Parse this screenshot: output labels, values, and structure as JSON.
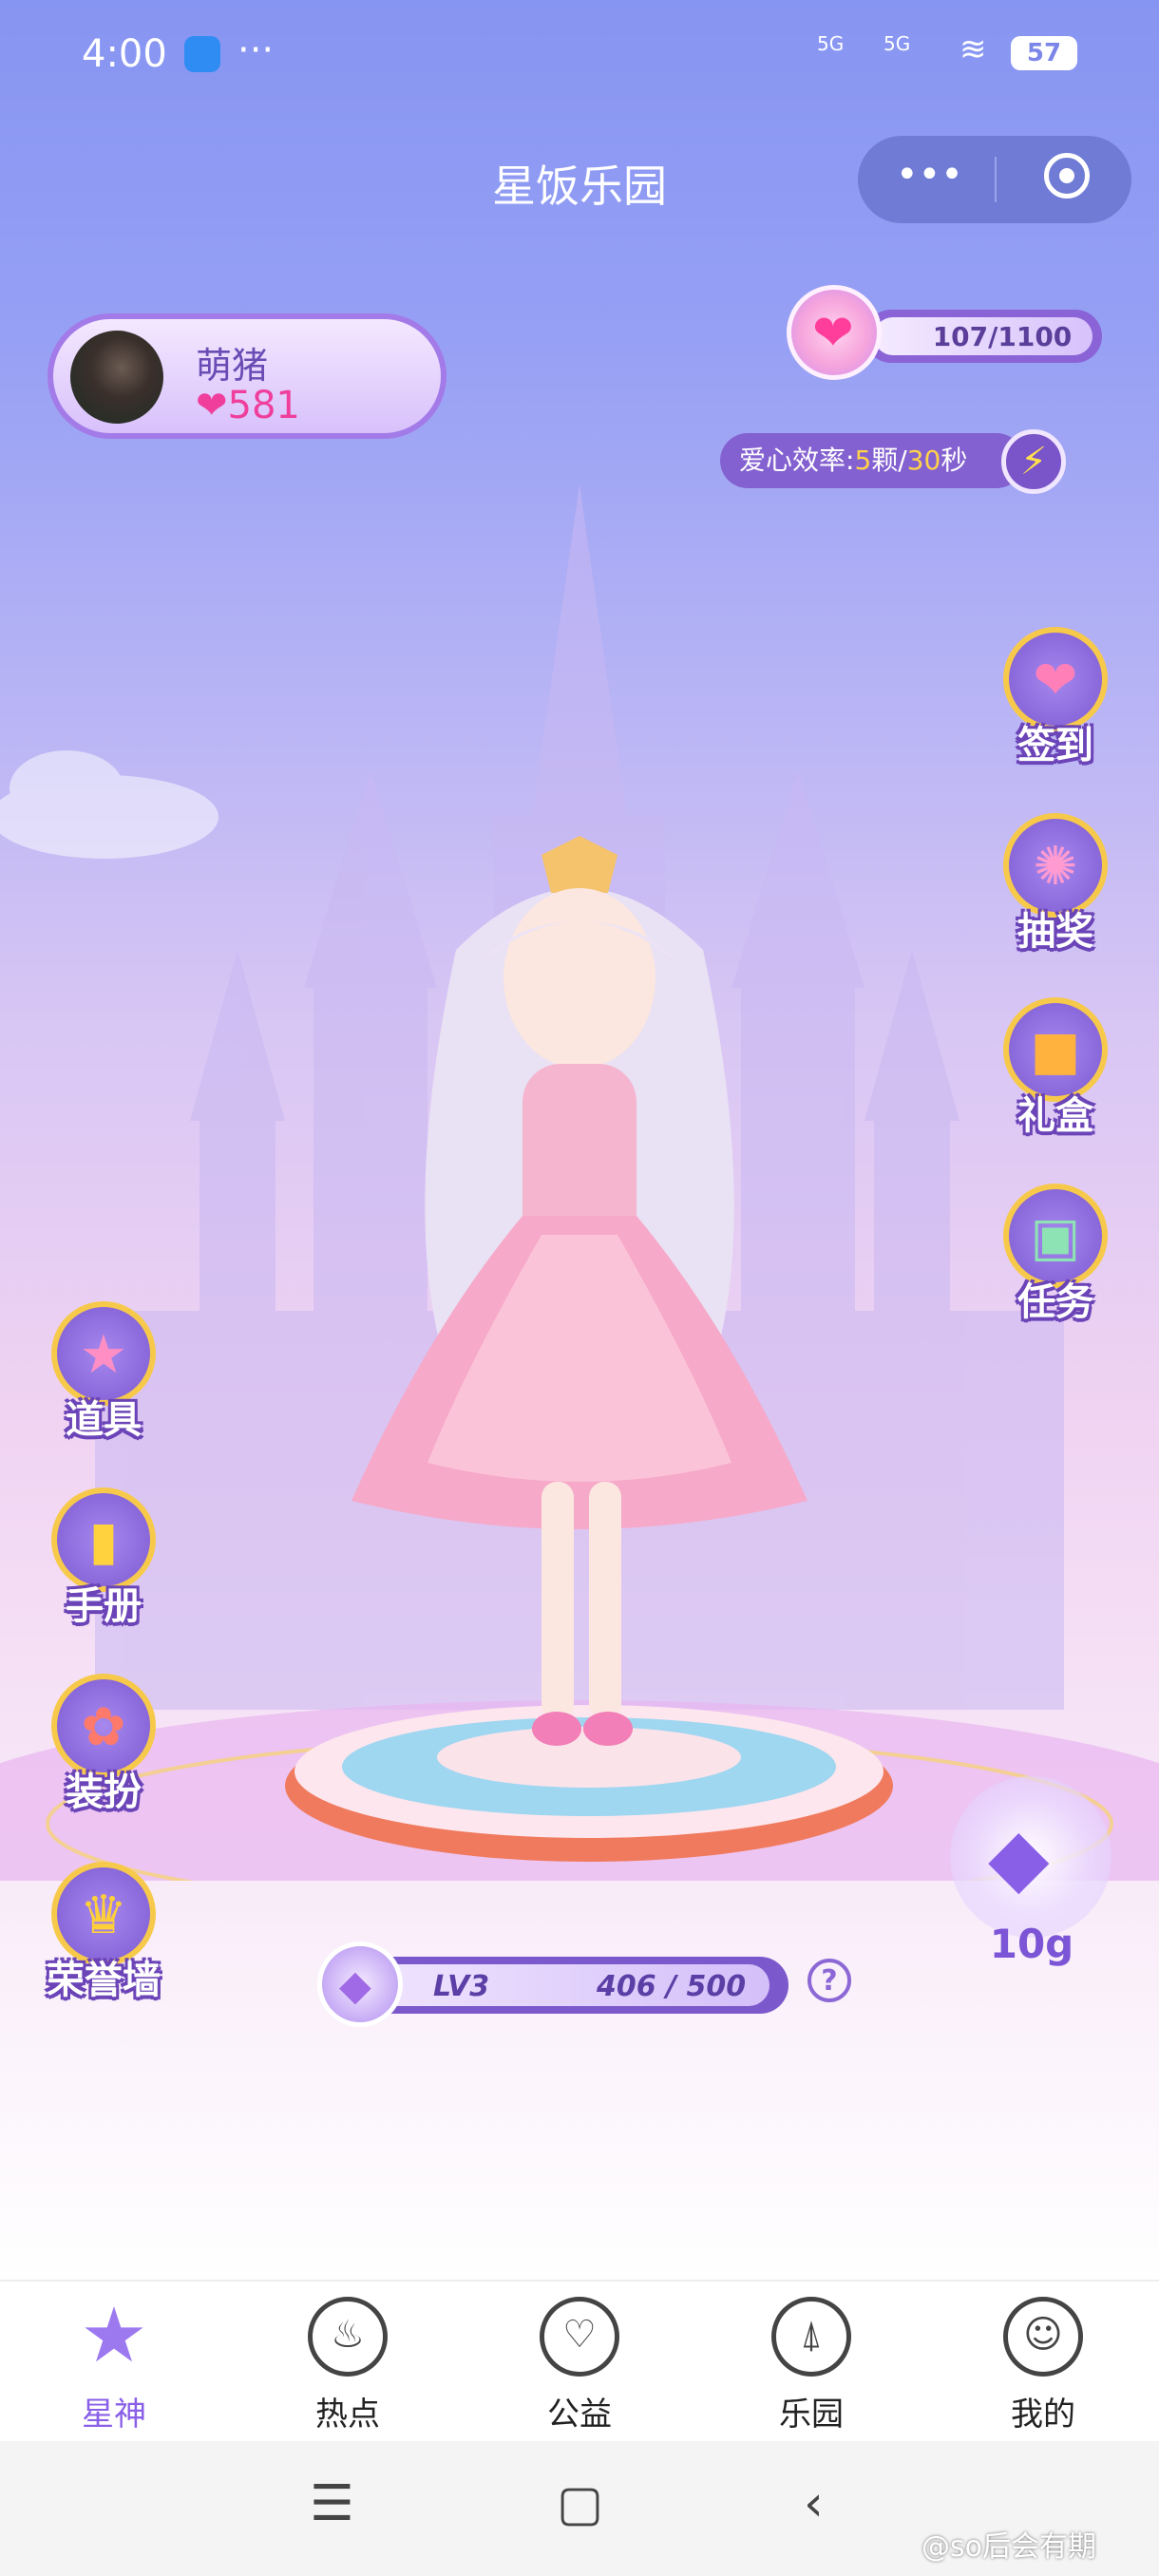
{
  "status_bar": {
    "time": "4:00",
    "more": "···",
    "signal1": "5G",
    "signal2": "5G",
    "battery": "57"
  },
  "title_bar": {
    "title": "星饭乐园",
    "more_label": "•••"
  },
  "user": {
    "name": "萌猪",
    "hearts": "581"
  },
  "heart_meter": {
    "value": "107/1100"
  },
  "efficiency": {
    "prefix": "爱心效率:",
    "count": "5",
    "unit_mid": "颗/",
    "seconds": "30",
    "unit_end": "秒"
  },
  "right_buttons": [
    {
      "label": "签到",
      "icon": "sign-in-icon"
    },
    {
      "label": "抽奖",
      "icon": "lottery-wheel-icon"
    },
    {
      "label": "礼盒",
      "icon": "gift-box-icon"
    },
    {
      "label": "任务",
      "icon": "task-calendar-icon"
    }
  ],
  "left_buttons": [
    {
      "label": "道具",
      "icon": "star-wand-icon"
    },
    {
      "label": "手册",
      "icon": "handbook-icon"
    },
    {
      "label": "装扮",
      "icon": "dressup-wand-icon"
    },
    {
      "label": "荣誉墙",
      "icon": "trophy-icon"
    }
  ],
  "level": {
    "lv": "LV3",
    "points": "406 / 500",
    "help": "?"
  },
  "gem": {
    "amount": "10g"
  },
  "tabs": [
    {
      "label": "星神",
      "icon": "star-icon",
      "active": true
    },
    {
      "label": "热点",
      "icon": "fire-icon"
    },
    {
      "label": "公益",
      "icon": "heart-icon"
    },
    {
      "label": "乐园",
      "icon": "ferris-wheel-icon"
    },
    {
      "label": "我的",
      "icon": "smile-icon"
    }
  ],
  "watermark": "@so后会有期",
  "colors": {
    "accent": "#8a5fe8",
    "heart": "#ef3e9b",
    "gold": "#f7c94b"
  }
}
